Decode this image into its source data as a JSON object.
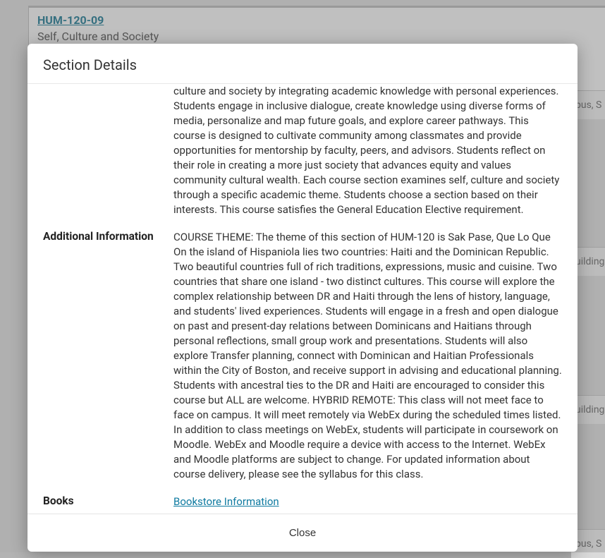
{
  "bg": {
    "course_code": "HUM-120-09",
    "course_title": "Self, Culture and Society",
    "row1": "pus, S",
    "row2": "uilding",
    "row3": "uilding",
    "row4": "pus, S"
  },
  "modal": {
    "title": "Section Details",
    "close_label": "Close"
  },
  "details": {
    "description_label": "",
    "description": "culture and society by integrating academic knowledge with personal experiences. Students engage in inclusive dialogue, create knowledge using diverse forms of media, personalize and map future goals, and explore career pathways. This course is designed to cultivate community among classmates and provide opportunities for mentorship by faculty, peers, and advisors. Students reflect on their role in creating a more just society that advances equity and values community cultural wealth. Each course section examines self, culture and society through a specific academic theme. Students choose a section based on their interests. This course satisfies the General Education Elective requirement.",
    "additional_label": "Additional Information",
    "additional": "COURSE THEME: The theme of this section of HUM-120 is Sak Pase, Que Lo Que On the island of Hispaniola lies two countries: Haiti and the Dominican Republic. Two beautiful countries full of rich traditions, expressions, music and cuisine. Two countries that share one island - two distinct cultures. This course will explore the complex relationship between DR and Haiti through the lens of history, language, and students' lived experiences. Students will engage in a fresh and open dialogue on past and present-day relations between Dominicans and Haitians through personal reflections, small group work and presentations. Students will also explore Transfer planning, connect with Dominican and Haitian Professionals within the City of Boston, and receive support in advising and educational planning. Students with ancestral ties to the DR and Haiti are encouraged to consider this course but ALL are welcome. HYBRID REMOTE: This class will not meet face to face on campus. It will meet remotely via WebEx during the scheduled times listed. In addition to class meetings on WebEx, students will participate in coursework on Moodle. WebEx and Moodle require a device with access to the Internet. WebEx and Moodle platforms are subject to change. For updated information about course delivery, please see the syllabus for this class.",
    "books_label": "Books",
    "books_link": "Bookstore Information"
  }
}
